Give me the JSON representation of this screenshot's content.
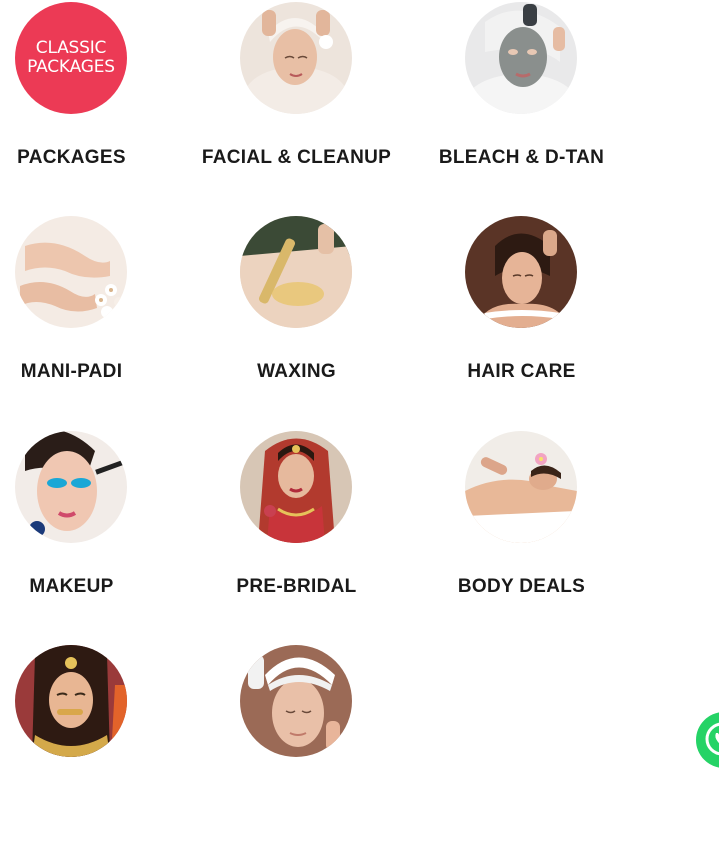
{
  "classic_badge": {
    "line1": "CLASSIC",
    "line2": "PACKAGES"
  },
  "categories": [
    {
      "label": "PACKAGES",
      "icon": "classic-packages-badge"
    },
    {
      "label": "FACIAL & CLEANUP",
      "icon": "facial-photo"
    },
    {
      "label": "BLEACH & D-TAN",
      "icon": "face-mask-photo"
    },
    {
      "label": "MANI-PADI",
      "icon": "hands-feet-photo"
    },
    {
      "label": "WAXING",
      "icon": "waxing-photo"
    },
    {
      "label": "HAIR CARE",
      "icon": "hair-massage-photo"
    },
    {
      "label": "MAKEUP",
      "icon": "makeup-photo"
    },
    {
      "label": "PRE-BRIDAL",
      "icon": "bride-photo"
    },
    {
      "label": "BODY DEALS",
      "icon": "body-massage-photo"
    },
    {
      "label": "",
      "icon": "bridal-makeup-photo"
    },
    {
      "label": "",
      "icon": "facial-towel-photo"
    }
  ],
  "colors": {
    "accent": "#ec3a55",
    "label_text": "#1a1a1a",
    "whatsapp": "#25d366"
  },
  "floating_button": {
    "icon": "whatsapp-icon"
  }
}
